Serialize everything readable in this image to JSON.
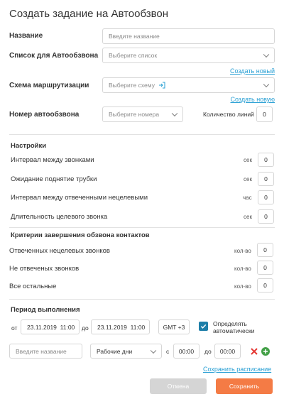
{
  "title": "Создать задание на Автообзвон",
  "form": {
    "name_label": "Название",
    "name_placeholder": "Введите название",
    "list_label": "Список для Автообзвона",
    "list_placeholder": "Выберите список",
    "create_new_link": "Создать новый",
    "routing_label": "Схема маршрутизации",
    "routing_placeholder": "Выберите схему",
    "create_new2_link": "Создать новую",
    "number_label": "Номер автообзвона",
    "number_placeholder": "Выберите номера",
    "lines_label": "Количество линий",
    "lines_value": "0"
  },
  "settings": {
    "heading": "Настройки",
    "rows": [
      {
        "label": "Интервал между звонками",
        "unit": "сек",
        "value": "0"
      },
      {
        "label": "Ожидание поднятие трубки",
        "unit": "сек",
        "value": "0"
      },
      {
        "label": "Интервал между отвеченными нецелевыми",
        "unit": "час",
        "value": "0"
      },
      {
        "label": "Длительность целевого звонка",
        "unit": "сек",
        "value": "0"
      }
    ]
  },
  "criteria": {
    "heading": "Критерии завершения обзвона контактов",
    "rows": [
      {
        "label": "Отвеченных нецелевых звонков",
        "unit": "кол-во",
        "value": "0"
      },
      {
        "label": "Не отвеченых звонков",
        "unit": "кол-во",
        "value": "0"
      },
      {
        "label": "Все остальные",
        "unit": "кол-во",
        "value": "0"
      }
    ]
  },
  "period": {
    "heading": "Период выполнения",
    "from_label": "от",
    "from_value": "23.11.2019  11:00",
    "to_label": "до",
    "to_value": "23.11.2019  11:00",
    "timezone": "GMT +3",
    "auto_label_1": "Определять",
    "auto_label_2": "автоматически"
  },
  "schedule": {
    "name_placeholder": "Введите название",
    "days_value": "Рабочие дни",
    "from_label": "с",
    "from_time": "00:00",
    "to_label": "до",
    "to_time": "00:00",
    "save_link": "Сохранить расписание"
  },
  "buttons": {
    "cancel": "Отмена",
    "save": "Сохранить"
  },
  "colors": {
    "link": "#2aa0d4",
    "save": "#f47b45",
    "cancel": "#d5d5d5",
    "checkbox": "#1d7ea8",
    "remove": "#e53935",
    "add": "#43a047"
  }
}
